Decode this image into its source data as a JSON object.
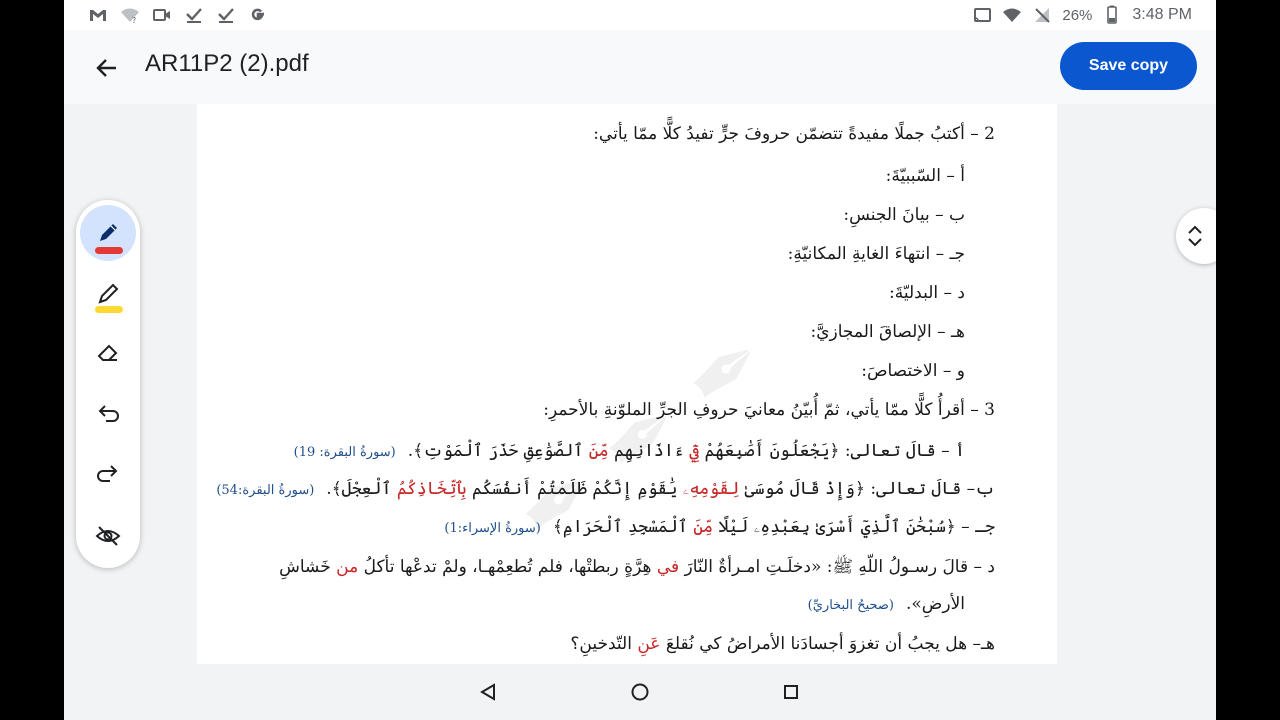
{
  "status": {
    "time": "3:48 PM",
    "battery": "26%",
    "left_icons": [
      "gmail-icon",
      "wifi-question-icon",
      "video-camera-icon",
      "check-icon",
      "check-icon",
      "google-icon"
    ],
    "right_icons": [
      "cast-icon",
      "wifi-icon",
      "no-signal-icon",
      "battery-icon"
    ]
  },
  "appbar": {
    "title": "AR11P2 (2).pdf",
    "save_label": "Save copy",
    "accent": "#0b57d0"
  },
  "document": {
    "lines": [
      "2 – أكتبُ جملًا مفيدةً تتضمّن حروفَ جرٍّ تفيدُ كلًّا ممّا يأتي:",
      "أ – السّببيّةَ:",
      "ب – بيانَ الجنسِ:",
      "جـ – انتهاءَ الغايةِ المكانيّةِ:",
      "د – البدليّةَ:",
      "هـ – الإلصاقَ المجازيَّ:",
      "و – الاختصاصَ:",
      "3 – أقرأُ كلًّا ممّا يأتي، ثمّ أُبيّنُ معانيَ حروفِ الجرِّ الملوّنةِ بالأحمرِ:"
    ],
    "verse_a": {
      "prefix": "أ – قالَ تعالى: ﴿يَجْعَلُونَ أَصَٰبِعَهُمْ ",
      "red1": "فِيٓ",
      "mid": " ءَاذَانِهِم ",
      "red2": "مِّنَ",
      "suffix": " ٱلصَّوَٰعِقِ حَذَرَ ٱلْمَوْتِ﴾.",
      "ref": "(سورةُ البقرة: 19)"
    },
    "verse_b": {
      "prefix": "ب– قالَ تعالى: ﴿وَإِذْ قَالَ مُوسَىٰ ",
      "red1": "لِقَوْمِهِۦ",
      "mid": " يَٰقَوْمِ إِنَّكُمْ ظَلَمْتُمْ أَنفُسَكُم ",
      "red2": "بِٱتِّخَاذِكُمُ",
      "suffix": " ٱلْعِجْلَ﴾.",
      "ref": "(سورةُ البقرة:54)"
    },
    "verse_c": {
      "prefix": "جـ – ﴿سُبْحَٰنَ ٱلَّذِيٓ أَسْرَىٰ بِعَبْدِهِۦ لَيْلًا ",
      "red1": "مِّنَ",
      "suffix": " ٱلْمَسْجِدِ ٱلْحَرَامِ﴾",
      "ref": "(سورةُ الإسراء:1)"
    },
    "hadith": {
      "prefix": "د – قالَ رسـولُ اللّهِ ﷺ: «دخلَـتِ امـرأةٌ النّارَ ",
      "red1": "في",
      "mid": " هِرَّةٍ ربطتْها، فلم تُطعِمْهـا، ولمْ تدعْها تأكلُ ",
      "red2": "من",
      "suffix": " خَشاشِ",
      "line2": "الأرضِ».",
      "ref": "(صحيحُ البخاريِّ)"
    },
    "question_e": {
      "prefix": "هـ– هل يجبُ أن تغزوَ أجسادَنا الأمراضُ كي نُقلعَ ",
      "red1": "عَنِ",
      "suffix": " التّدخينِ؟"
    },
    "highlight_color": "#c62828"
  },
  "tools": {
    "items": [
      "pen-icon",
      "highlighter-icon",
      "eraser-icon",
      "undo-icon",
      "redo-icon",
      "hide-annotations-icon"
    ],
    "pen_color": "#e53935",
    "highlighter_color": "#fdd835"
  },
  "navbar": {
    "buttons": [
      "back-triangle-icon",
      "home-circle-icon",
      "recents-square-icon"
    ]
  }
}
